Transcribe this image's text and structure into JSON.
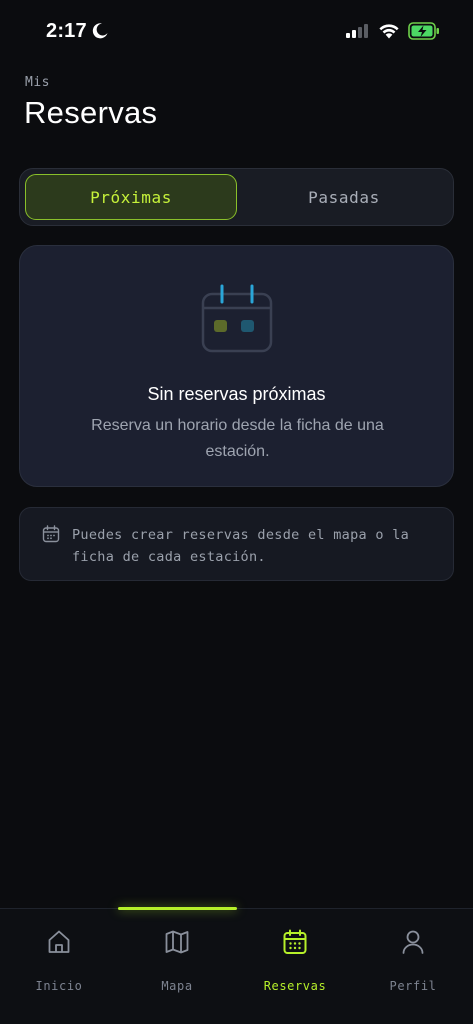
{
  "status_bar": {
    "time": "2:17"
  },
  "header": {
    "eyebrow": "Mis",
    "title": "Reservas"
  },
  "tabs": [
    {
      "label": "Próximas",
      "active": true
    },
    {
      "label": "Pasadas",
      "active": false
    }
  ],
  "empty_state": {
    "title": "Sin reservas próximas",
    "description": "Reserva un horario desde la ficha de una estación.",
    "icon": "calendar-icon"
  },
  "info_note": {
    "icon": "calendar-icon",
    "text": "Puedes crear reservas desde el mapa o la ficha de cada estación."
  },
  "nav": [
    {
      "label": "Inicio",
      "icon": "home-icon",
      "active": false
    },
    {
      "label": "Mapa",
      "icon": "map-icon",
      "active": false
    },
    {
      "label": "Reservas",
      "icon": "calendar-icon",
      "active": true
    },
    {
      "label": "Perfil",
      "icon": "user-icon",
      "active": false
    }
  ],
  "colors": {
    "background": "#0b0c0f",
    "accent": "#b6f02a",
    "card": "#1c2030",
    "muted_text": "#9aa0ab"
  }
}
